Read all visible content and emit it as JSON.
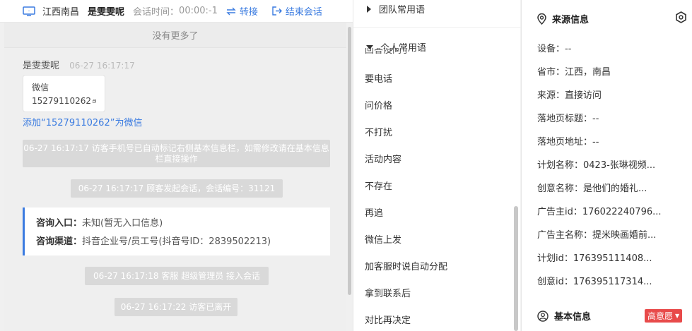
{
  "header": {
    "location": "江西南昌",
    "nickname": "是雯雯呢",
    "session_time_label": "会话时间：",
    "session_time_value": "00:00:-1",
    "transfer_label": "转接",
    "end_label": "结束会话"
  },
  "chat": {
    "no_more": "没有更多了",
    "sender": "是雯雯呢",
    "sender_time": "06-27 16:17:17",
    "card_title": "微信",
    "card_number": "15279110262",
    "add_link": "添加“15279110262”为微信",
    "sys_auto_mark": "06-27 16:17:17 访客手机号已自动标记右侧基本信息栏，如需修改请在基本信息栏直接操作",
    "sys_session_start": "06-27 16:17:17 顾客发起会话，会话编号：31121",
    "consult_entry_label": "咨询入口：",
    "consult_entry_value": "未知(暂无入口信息)",
    "consult_channel_label": "咨询渠道：",
    "consult_channel_value": "抖音企业号/员工号(抖音号ID：2839502213)",
    "sys_agent_join": "06-27 16:17:18 客服 超级管理员 接入会话",
    "sys_visitor_left": "06-27 16:17:22 访客已离开"
  },
  "phrases": {
    "team_group": "团队常用语",
    "personal_group": "个人常用语",
    "partial_item": "回答没问了",
    "items": [
      "要电话",
      "问价格",
      "不打扰",
      "活动内容",
      "不存在",
      "再追",
      "微信上发",
      "加客服时说自动分配",
      "拿到联系后",
      "对比再决定"
    ]
  },
  "info": {
    "source_title": "来源信息",
    "fields": [
      "设备：--",
      "省市：江西，南昌",
      "来源：直接访问",
      "落地页标题：--",
      "落地页地址：--",
      "计划名称：0423-张琳视频...",
      "创意名称：是他们的婚礼...",
      "广告主id：176022240796...",
      "广告主名称：提米映画婚前...",
      "计划id：176395111408...",
      "创意id：176395117314..."
    ],
    "basic_title": "基本信息",
    "intent_badge": "高意愿"
  },
  "colors": {
    "accent": "#3a7be0",
    "badge": "#e84a4a"
  }
}
